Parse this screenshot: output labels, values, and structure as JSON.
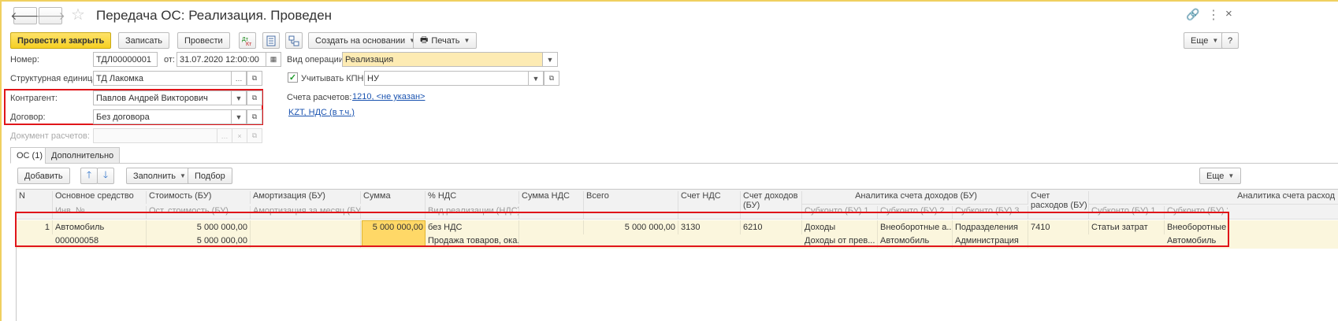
{
  "window": {
    "title": "Передача ОС: Реализация. Проведен"
  },
  "toolbar": {
    "post_close": "Провести и закрыть",
    "save": "Записать",
    "post": "Провести",
    "create_based": "Создать на основании",
    "print": "Печать",
    "more": "Еще",
    "help": "?"
  },
  "form": {
    "number_label": "Номер:",
    "number_value": "ТДЛ00000001",
    "date_label": "от:",
    "date_value": "31.07.2020 12:00:00",
    "operation_label": "Вид операции:",
    "operation_value": "Реализация",
    "unit_label": "Структурная единица:",
    "unit_value": "ТД Лакомка",
    "kpn_label": "Учитывать КПН",
    "kpn_value": "НУ",
    "counterparty_label": "Контрагент:",
    "counterparty_value": "Павлов Андрей Викторович",
    "accounts_label": "Счета расчетов:",
    "accounts_link": "1210, <не указан>",
    "contract_label": "Договор:",
    "contract_value": "Без договора",
    "vat_link": "KZT, НДС (в т.ч.)",
    "settlement_doc_label": "Документ расчетов:",
    "settlement_doc_value": ""
  },
  "tabs": [
    {
      "label": "ОС (1)"
    },
    {
      "label": "Дополнительно"
    }
  ],
  "table_toolbar": {
    "add": "Добавить",
    "fill": "Заполнить",
    "select": "Подбор",
    "more": "Еще"
  },
  "table": {
    "headers": {
      "n": "N",
      "asset": "Основное средство",
      "inv": "Инв. №",
      "cost": "Стоимость (БУ)",
      "residual": "Ост. стоимость (БУ)",
      "amort": "Амортизация (БУ)",
      "amort_month": "Амортизация за месяц (БУ)",
      "sum": "Сумма",
      "vat_rate": "% НДС",
      "sale_kind": "Вид реализации (НДС)",
      "vat_sum": "Сумма НДС",
      "total": "Всего",
      "vat_acc": "Счет НДС",
      "income_acc": "Счет доходов (БУ)",
      "income_analytics": "Аналитика счета доходов (БУ)",
      "sub1": "Субконто (БУ) 1",
      "sub2": "Субконто (БУ) 2",
      "sub3": "Субконто (БУ) 3",
      "expense_acc": "Счет расходов (БУ)",
      "expense_analytics": "Аналитика счета расход",
      "esub1": "Субконто (БУ) 1",
      "esub2": "Субконто (БУ) 2"
    },
    "rows": [
      {
        "n": "1",
        "asset": "Автомобиль",
        "inv": "000000058",
        "cost": "5 000 000,00",
        "residual": "5 000 000,00",
        "amort": "",
        "amort_month": "",
        "sum": "5 000 000,00",
        "vat_rate": "без НДС",
        "sale_kind": "Продажа товаров, ока...",
        "vat_sum": "",
        "total": "5 000 000,00",
        "vat_acc": "3130",
        "income_acc": "6210",
        "sub1a": "Доходы",
        "sub1b": "Доходы от прев...",
        "sub2a": "Внеоборотные а...",
        "sub2b": "Автомобиль",
        "sub3a": "Подразделения",
        "sub3b": "Администрация",
        "expense_acc": "7410",
        "esub1a": "Статьи затрат",
        "esub2a": "Внеоборотные а...",
        "esub2b": "Автомобиль"
      }
    ]
  }
}
